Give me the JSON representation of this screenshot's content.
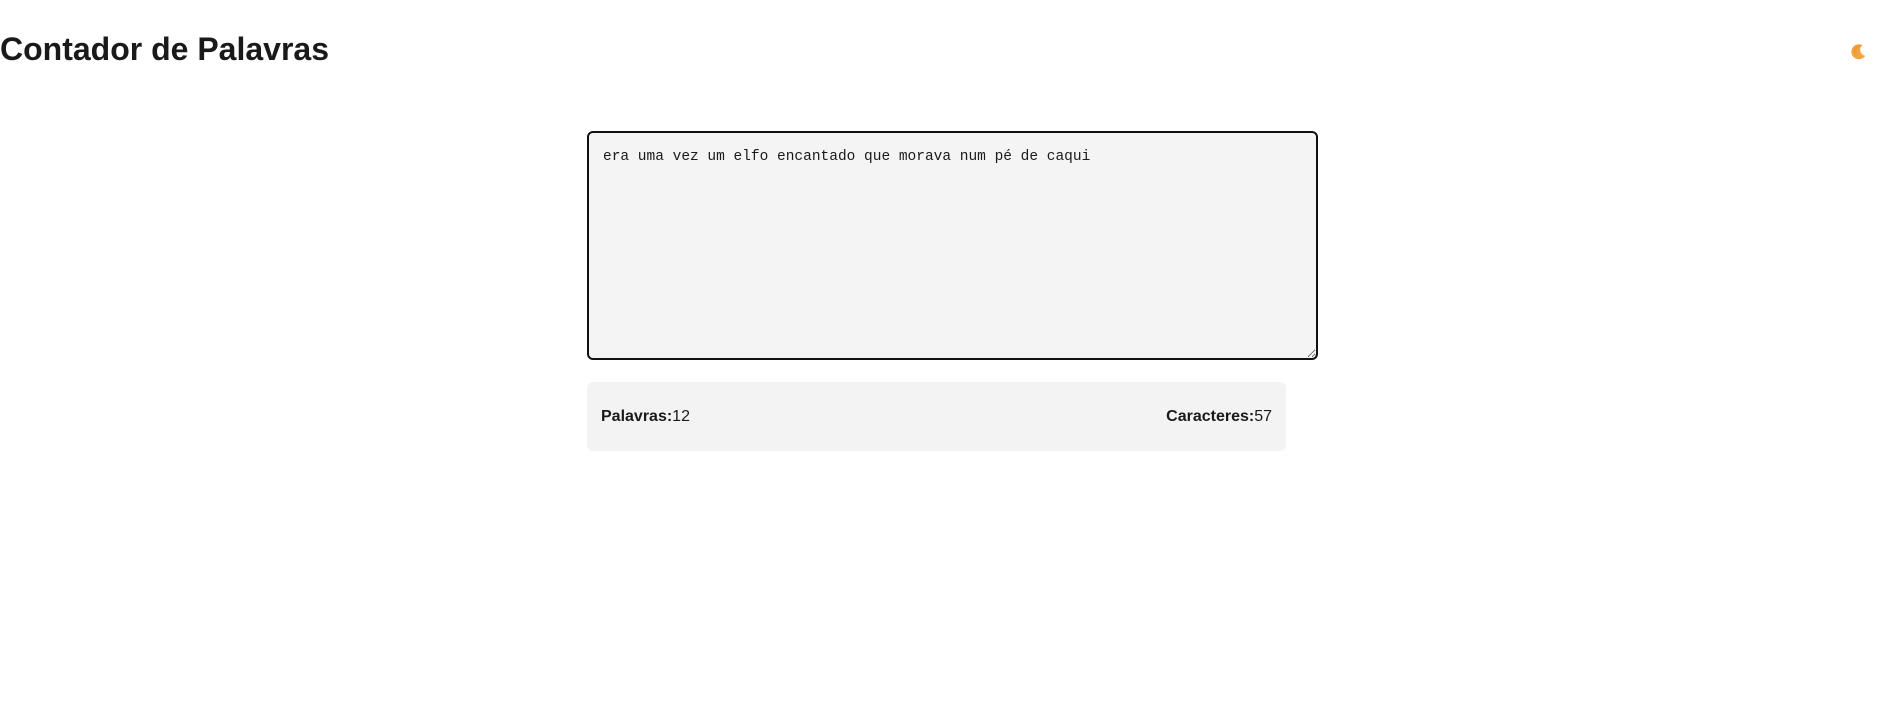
{
  "header": {
    "title": "Contador de Palavras",
    "theme_toggle_icon": "moon-icon"
  },
  "editor": {
    "text": "era uma vez um elfo encantado que morava num pé de caqui"
  },
  "stats": {
    "words_label": "Palavras:",
    "words_value": "12",
    "chars_label": "Caracteres:",
    "chars_value": "57"
  },
  "colors": {
    "moon": "#f4a340",
    "panel_background": "#f3f3f3",
    "textarea_border": "#111111"
  }
}
